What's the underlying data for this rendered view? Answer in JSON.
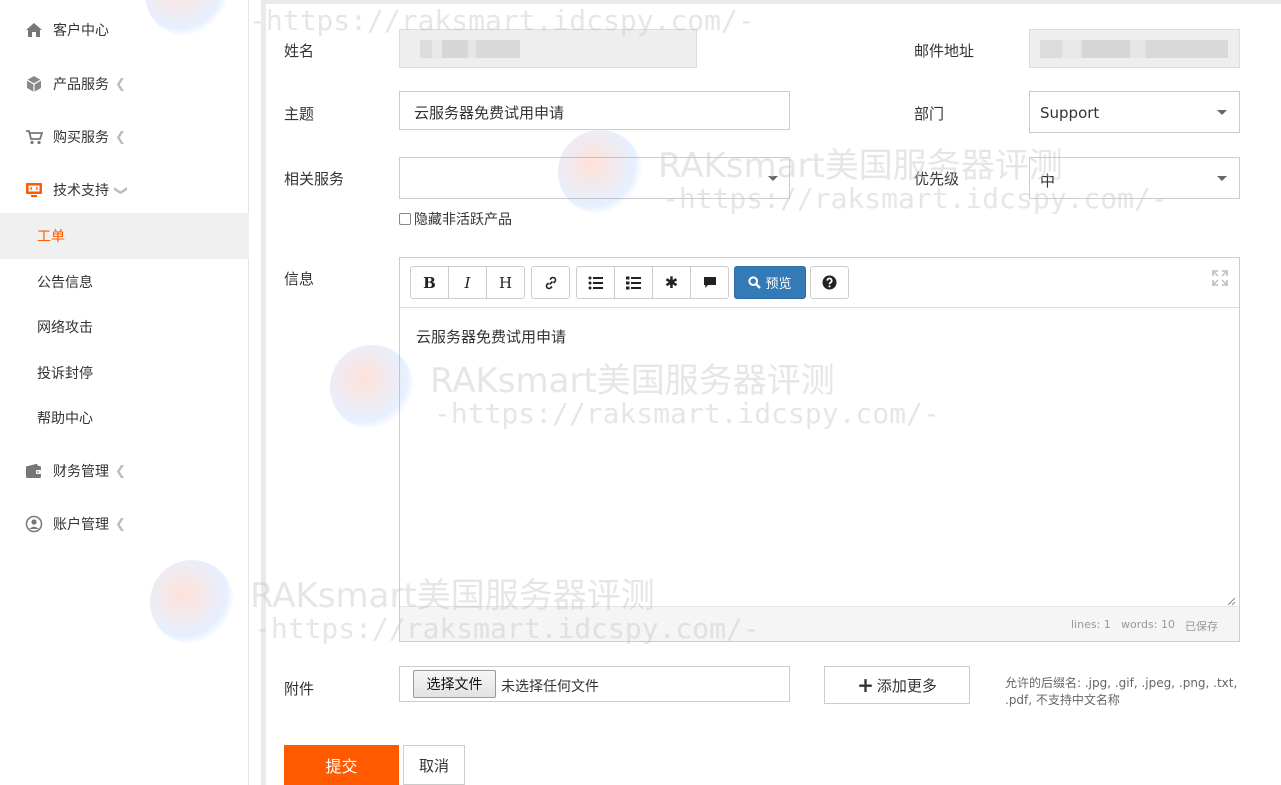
{
  "sidebar": {
    "items": [
      {
        "label": "客户中心",
        "icon": "home-icon",
        "has_chevron": false
      },
      {
        "label": "产品服务",
        "icon": "cube-icon",
        "has_chevron": true
      },
      {
        "label": "购买服务",
        "icon": "cart-icon",
        "has_chevron": true
      },
      {
        "label": "技术支持",
        "icon": "monitor-icon",
        "has_chevron": true,
        "expanded": true
      },
      {
        "label": "财务管理",
        "icon": "wallet-icon",
        "has_chevron": true
      },
      {
        "label": "账户管理",
        "icon": "user-circle-icon",
        "has_chevron": true
      }
    ],
    "subitems": [
      {
        "label": "工单",
        "active": true
      },
      {
        "label": "公告信息"
      },
      {
        "label": "网络攻击"
      },
      {
        "label": "投诉封停"
      },
      {
        "label": "帮助中心"
      }
    ]
  },
  "form": {
    "name_label": "姓名",
    "email_label": "邮件地址",
    "subject_label": "主题",
    "subject_value": "云服务器免费试用申请",
    "department_label": "部门",
    "department_value": "Support",
    "service_label": "相关服务",
    "service_value": "",
    "priority_label": "优先级",
    "priority_value": "中",
    "hide_inactive_label": "隐藏非活跃产品",
    "message_label": "信息",
    "attachment_label": "附件"
  },
  "editor": {
    "tools": {
      "bold": "B",
      "italic": "I",
      "heading": "H",
      "preview": "预览"
    },
    "content": "云服务器免费试用申请",
    "status_lines": "lines: 1",
    "status_words": "words: 10",
    "status_saved": "已保存"
  },
  "attachment": {
    "choose_button": "选择文件",
    "no_file": "未选择任何文件",
    "add_more": "添加更多",
    "hint": "允许的后缀名: .jpg, .gif, .jpeg, .png, .txt, .pdf, 不支持中文名称"
  },
  "actions": {
    "submit": "提交",
    "cancel": "取消"
  },
  "watermark": {
    "title": "RAKsmart美国服务器评测",
    "url": "-https://raksmart.idcspy.com/-"
  },
  "colors": {
    "accent": "#ff5a00",
    "primary_button": "#337ab7",
    "active_nav_bg": "#f0f0f0"
  }
}
